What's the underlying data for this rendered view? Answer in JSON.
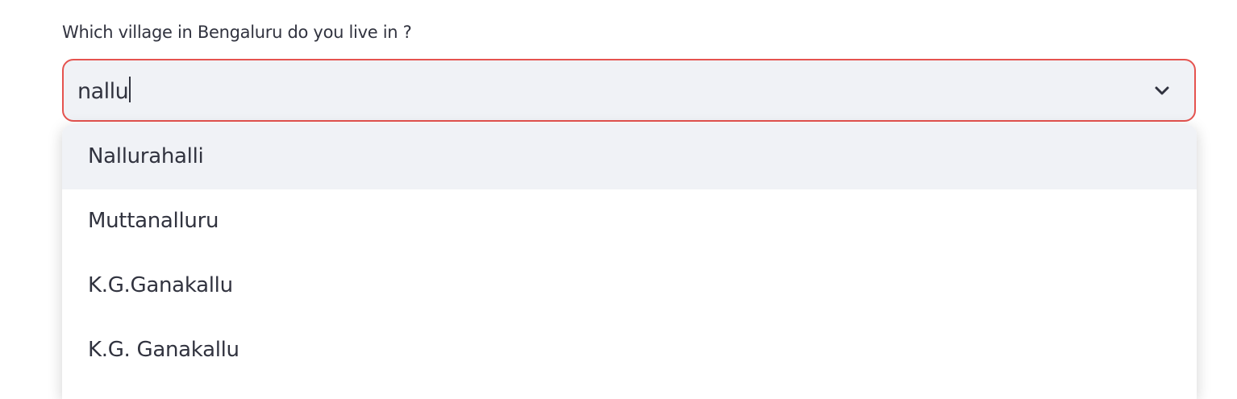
{
  "field": {
    "label": "Which village in Bengaluru do you live in ?",
    "input_value": "nallu",
    "border_color": "#e5534f",
    "icon": "chevron-down-icon"
  },
  "options": [
    {
      "label": "Nallurahalli",
      "highlighted": true
    },
    {
      "label": "Muttanalluru",
      "highlighted": false
    },
    {
      "label": "K.G.Ganakallu",
      "highlighted": false
    },
    {
      "label": "K.G. Ganakallu",
      "highlighted": false
    }
  ]
}
